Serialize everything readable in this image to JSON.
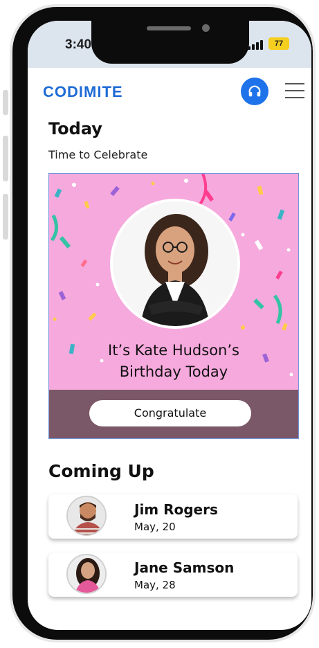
{
  "status_bar": {
    "time": "3:40",
    "battery": "77"
  },
  "header": {
    "logo": "CODIMITE",
    "support_icon": "headset-icon",
    "menu_icon": "hamburger-menu-icon",
    "accent_color": "#1f73ea"
  },
  "today": {
    "title": "Today",
    "subtitle": "Time to Celebrate",
    "birthday_line_1": "It’s Kate Hudson’s",
    "birthday_line_2": "Birthday Today",
    "button_label": "Congratulate",
    "card_color": "#f6a9dd",
    "footer_color": "#7b5867"
  },
  "coming_up": {
    "title": "Coming Up",
    "people": [
      {
        "name": "Jim Rogers",
        "date": "May, 20"
      },
      {
        "name": "Jane Samson",
        "date": "May, 28"
      }
    ]
  }
}
